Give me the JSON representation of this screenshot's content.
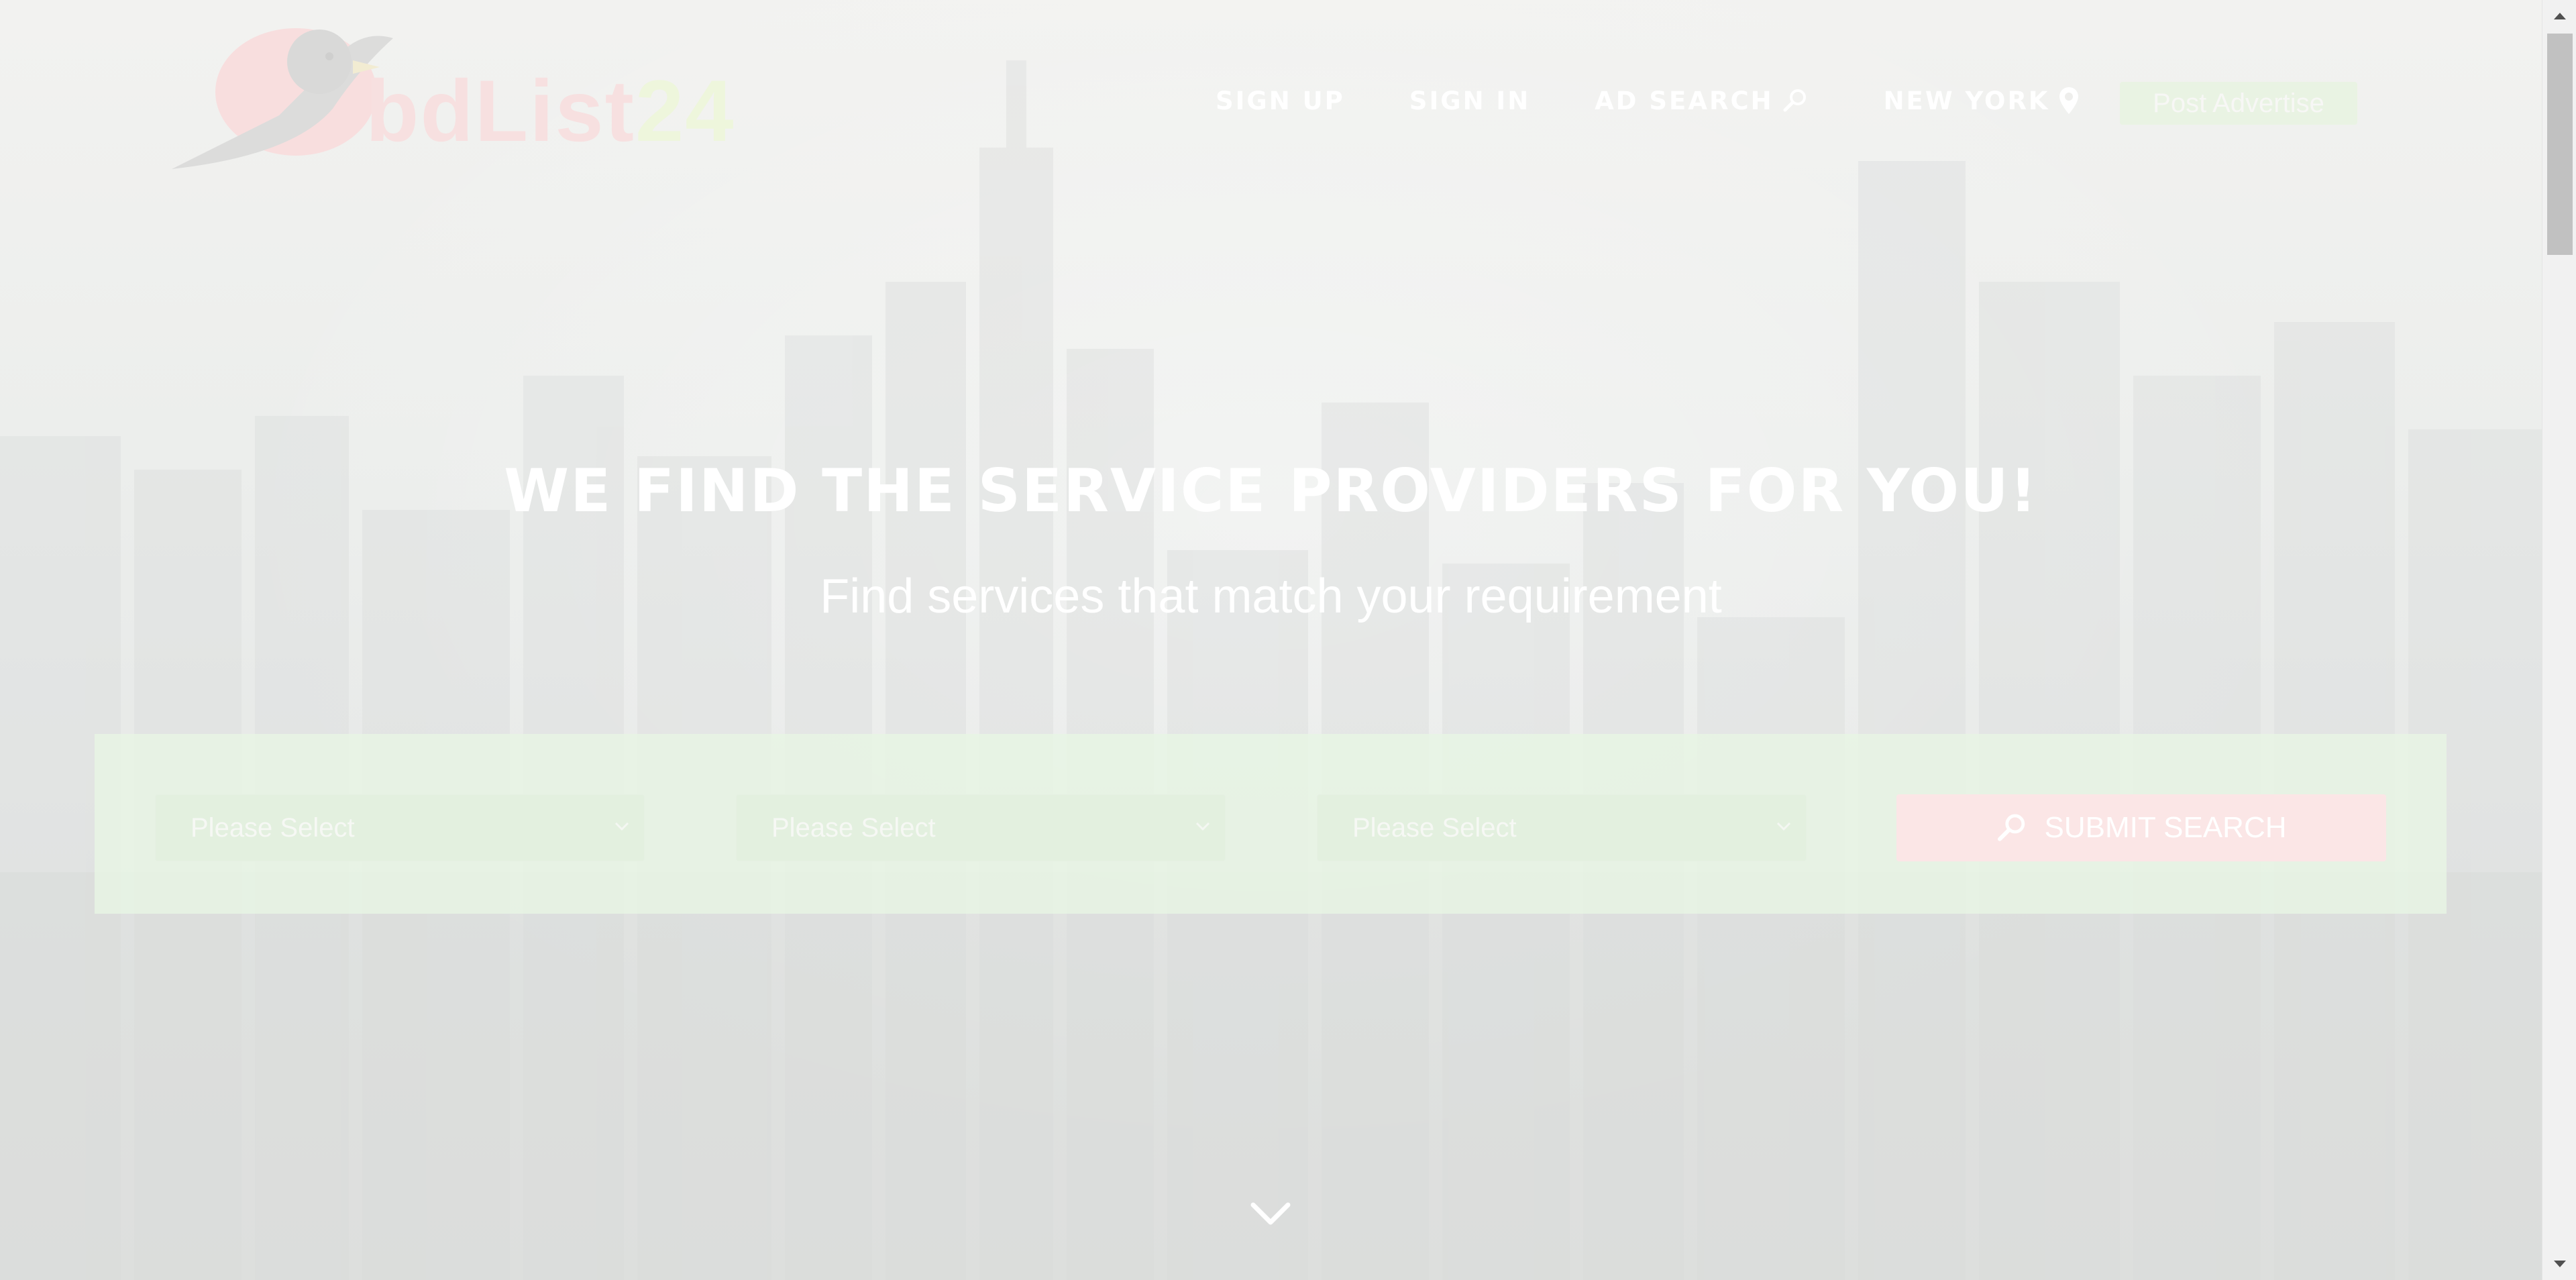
{
  "logo": {
    "text_main": "bdList",
    "text_number": "24"
  },
  "nav": {
    "sign_up": "SIGN UP",
    "sign_in": "SIGN IN",
    "ad_search": "AD SEARCH",
    "location": "NEW YORK",
    "ad_search_icon": "search-icon",
    "location_icon": "map-pin-icon"
  },
  "post_button": "Post Advertise",
  "hero": {
    "headline": "WE FIND THE SERVICE PROVIDERS FOR YOU!",
    "subheadline": "Find services that match your requirement"
  },
  "search": {
    "selects": [
      {
        "value": "Please Select"
      },
      {
        "value": "Please Select"
      },
      {
        "value": "Please Select"
      }
    ],
    "submit_label": "SUBMIT SEARCH",
    "submit_icon": "search-icon"
  },
  "scroll_down_icon": "chevron-down-icon",
  "colors": {
    "brand_green": "#e9f3e3",
    "brand_red": "#fbe6e6"
  }
}
